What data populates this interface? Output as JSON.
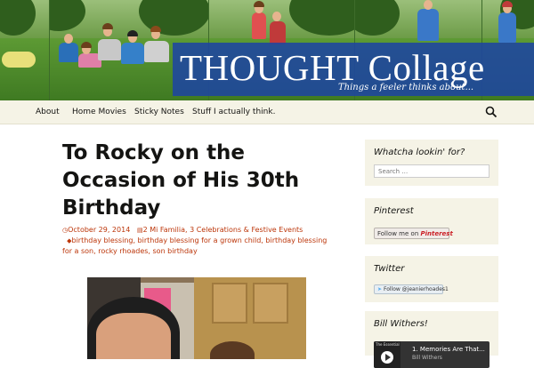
{
  "header": {
    "site_title": "THOUGHT Collage",
    "tagline": "Things a feeler thinks about..."
  },
  "nav": {
    "items": [
      {
        "label": "About"
      },
      {
        "label": "Home Movies"
      },
      {
        "label": "Sticky Notes"
      },
      {
        "label": "Stuff I actually think."
      }
    ],
    "search_icon": "search-icon"
  },
  "post": {
    "title": "To Rocky on the Occasion of His 30th Birthday",
    "date": "October 29, 2014",
    "categories": "2 Mi Familia, 3 Celebrations & Festive Events",
    "tags": "birthday blessing, birthday blessing for a grown child, birthday blessing for a son, rocky rhoades, son birthday"
  },
  "sidebar": {
    "search_widget": {
      "title": "Whatcha lookin' for?",
      "placeholder": "Search …"
    },
    "pinterest_widget": {
      "title": "Pinterest",
      "button_label": "Follow me on",
      "brand": "Pinterest"
    },
    "twitter_widget": {
      "title": "Twitter",
      "button_label": "Follow @jeanierhoades1"
    },
    "music_widget": {
      "title": "Bill Withers!",
      "track_title": "1. Memories Are That...",
      "track_artist": "Bill Withers",
      "album_label": "The Essential"
    }
  },
  "colors": {
    "accent": "#bc360a",
    "title_box": "#1e46a0",
    "nav_bg": "#f5f3e6"
  }
}
